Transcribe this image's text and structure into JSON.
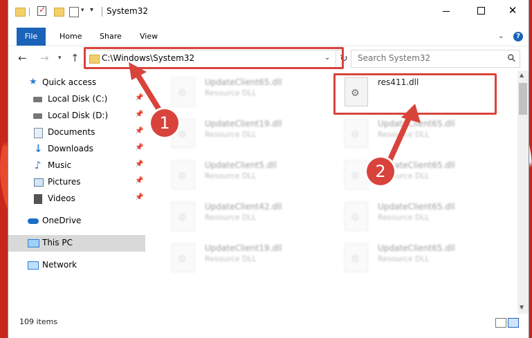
{
  "window": {
    "title": "System32",
    "controls": {
      "minimize": "minimize",
      "maximize": "maximize",
      "close": "✕"
    }
  },
  "ribbon": {
    "tabs": [
      "File",
      "Home",
      "Share",
      "View"
    ]
  },
  "nav": {
    "address": "C:\\Windows\\System32",
    "search_placeholder": "Search System32"
  },
  "sidebar": {
    "items": [
      {
        "label": "Quick access",
        "icon": "star-icon",
        "pinned": false
      },
      {
        "label": "Local Disk (C:)",
        "icon": "drive-icon",
        "pinned": true
      },
      {
        "label": "Local Disk (D:)",
        "icon": "drive-icon",
        "pinned": true
      },
      {
        "label": "Documents",
        "icon": "documents-icon",
        "pinned": true
      },
      {
        "label": "Downloads",
        "icon": "download-icon",
        "pinned": true
      },
      {
        "label": "Music",
        "icon": "music-icon",
        "pinned": true
      },
      {
        "label": "Pictures",
        "icon": "pictures-icon",
        "pinned": true
      },
      {
        "label": "Videos",
        "icon": "videos-icon",
        "pinned": true
      },
      {
        "label": "OneDrive",
        "icon": "cloud-icon",
        "pinned": false
      },
      {
        "label": "This PC",
        "icon": "computer-icon",
        "pinned": false,
        "selected": true
      },
      {
        "label": "Network",
        "icon": "network-icon",
        "pinned": false
      }
    ]
  },
  "files": [
    {
      "name": "UpdateClient65.dll",
      "type": "Resource DLL"
    },
    {
      "name": "res411.dll",
      "type": ""
    },
    {
      "name": "UpdateClient19.dll",
      "type": "Resource DLL"
    },
    {
      "name": "UpdateClient65.dll",
      "type": "Resource DLL"
    },
    {
      "name": "UpdateClient5.dll",
      "type": "Resource DLL"
    },
    {
      "name": "UpdateClient65.dll",
      "type": "Resource DLL"
    },
    {
      "name": "UpdateClient42.dll",
      "type": "Resource DLL"
    },
    {
      "name": "UpdateClient65.dll",
      "type": "Resource DLL"
    },
    {
      "name": "UpdateClient19.dll",
      "type": "Resource DLL"
    },
    {
      "name": "UpdateClient65.dll",
      "type": "Resource DLL"
    }
  ],
  "status": {
    "item_count": "109 items"
  },
  "annotations": {
    "step1": "1",
    "step2": "2",
    "color": "#d8433c"
  }
}
